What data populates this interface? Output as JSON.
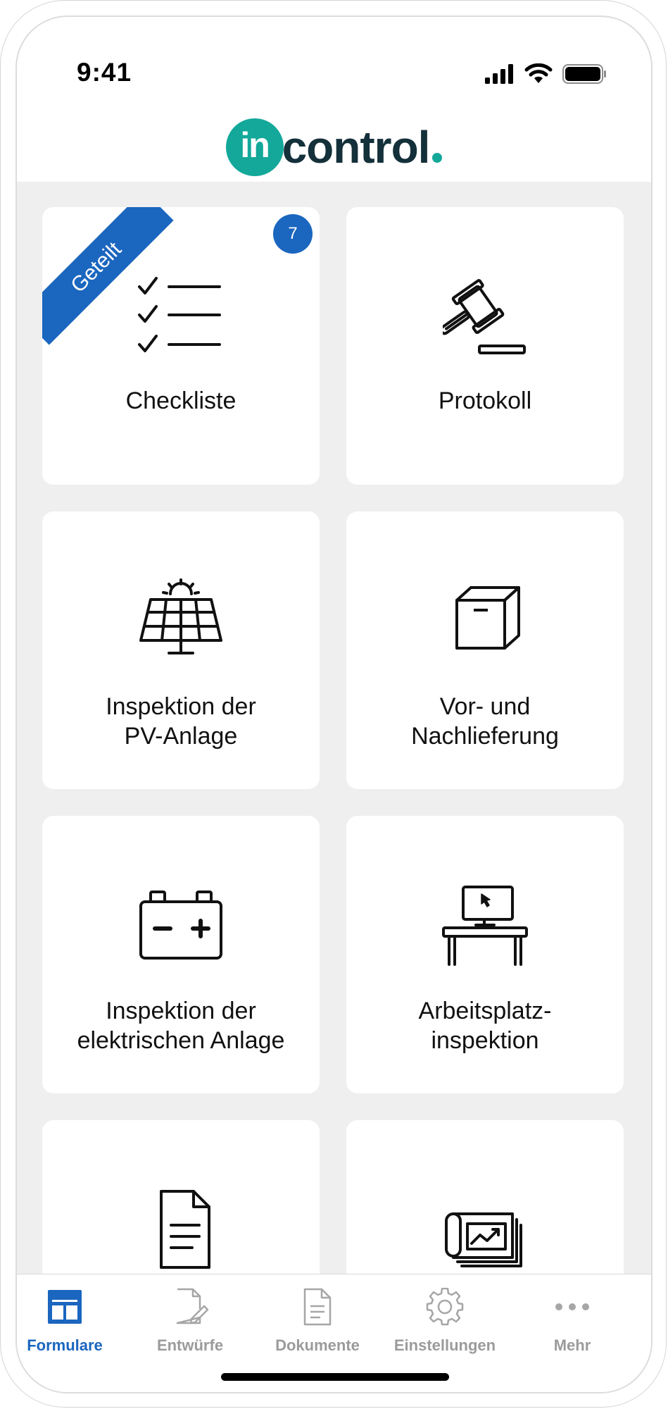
{
  "status": {
    "time": "9:41"
  },
  "brand": {
    "mark": "in",
    "word": "control",
    "primary_color": "#13a89a",
    "dark_color": "#14303a"
  },
  "accent_color": "#1b66bf",
  "cards": [
    {
      "label": "Checkliste",
      "icon": "checklist-icon",
      "ribbon": "Geteilt",
      "badge": "7"
    },
    {
      "label": "Protokoll",
      "icon": "gavel-icon"
    },
    {
      "label_lines": [
        "Inspektion der",
        "PV-Anlage"
      ],
      "icon": "solar-panel-icon"
    },
    {
      "label_lines": [
        "Vor- und",
        "Nachlieferung"
      ],
      "icon": "box-icon"
    },
    {
      "label_lines": [
        "Inspektion der",
        "elektrischen Anlage"
      ],
      "icon": "battery-icon"
    },
    {
      "label_lines": [
        "Arbeitsplatz-",
        "inspektion"
      ],
      "icon": "workstation-icon"
    },
    {
      "icon": "document-icon"
    },
    {
      "icon": "blueprint-chart-icon"
    }
  ],
  "tabs": [
    {
      "label": "Formulare",
      "icon": "forms-icon",
      "active": true
    },
    {
      "label": "Entwürfe",
      "icon": "draft-icon"
    },
    {
      "label": "Dokumente",
      "icon": "documents-icon"
    },
    {
      "label": "Einstellungen",
      "icon": "gear-icon"
    },
    {
      "label": "Mehr",
      "icon": "more-icon"
    }
  ]
}
